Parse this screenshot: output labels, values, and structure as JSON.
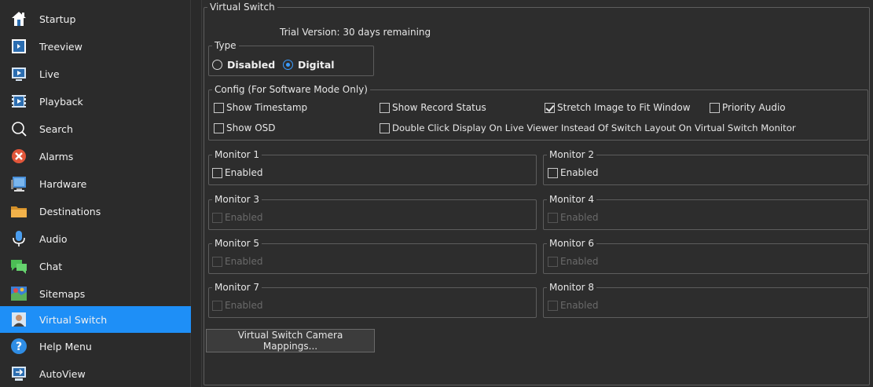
{
  "sidebar": {
    "items": [
      {
        "label": "Startup",
        "icon": "home-icon"
      },
      {
        "label": "Treeview",
        "icon": "treeview-icon"
      },
      {
        "label": "Live",
        "icon": "live-icon"
      },
      {
        "label": "Playback",
        "icon": "playback-icon"
      },
      {
        "label": "Search",
        "icon": "search-icon"
      },
      {
        "label": "Alarms",
        "icon": "alarm-icon"
      },
      {
        "label": "Hardware",
        "icon": "hardware-icon"
      },
      {
        "label": "Destinations",
        "icon": "folder-icon"
      },
      {
        "label": "Audio",
        "icon": "microphone-icon"
      },
      {
        "label": "Chat",
        "icon": "chat-icon"
      },
      {
        "label": "Sitemaps",
        "icon": "map-icon"
      },
      {
        "label": "Virtual Switch",
        "icon": "virtual-switch-icon",
        "active": true
      },
      {
        "label": "Help Menu",
        "icon": "help-icon"
      },
      {
        "label": "AutoView",
        "icon": "autoview-icon"
      }
    ],
    "active_color": "#1e8ff7"
  },
  "main": {
    "group_title": "Virtual Switch",
    "trial_text": "Trial Version: 30 days remaining",
    "type": {
      "title": "Type",
      "options": [
        {
          "label": "Disabled",
          "selected": false
        },
        {
          "label": "Digital",
          "selected": true
        }
      ]
    },
    "config": {
      "title": "Config (For Software Mode Only)",
      "options": [
        {
          "label": "Show Timestamp",
          "checked": false
        },
        {
          "label": "Show Record Status",
          "checked": false
        },
        {
          "label": "Stretch Image to Fit Window",
          "checked": true
        },
        {
          "label": "Priority Audio",
          "checked": false
        },
        {
          "label": "Show OSD",
          "checked": false
        },
        {
          "label": "Double Click Display On Live Viewer Instead Of Switch Layout On Virtual Switch Monitor",
          "checked": false
        }
      ]
    },
    "monitors": [
      {
        "title": "Monitor 1",
        "enabled_label": "Enabled",
        "disabled": false
      },
      {
        "title": "Monitor 2",
        "enabled_label": "Enabled",
        "disabled": false
      },
      {
        "title": "Monitor 3",
        "enabled_label": "Enabled",
        "disabled": true
      },
      {
        "title": "Monitor 4",
        "enabled_label": "Enabled",
        "disabled": true
      },
      {
        "title": "Monitor 5",
        "enabled_label": "Enabled",
        "disabled": true
      },
      {
        "title": "Monitor 6",
        "enabled_label": "Enabled",
        "disabled": true
      },
      {
        "title": "Monitor 7",
        "enabled_label": "Enabled",
        "disabled": true
      },
      {
        "title": "Monitor 8",
        "enabled_label": "Enabled",
        "disabled": true
      }
    ],
    "mappings_button": "Virtual Switch Camera Mappings..."
  }
}
